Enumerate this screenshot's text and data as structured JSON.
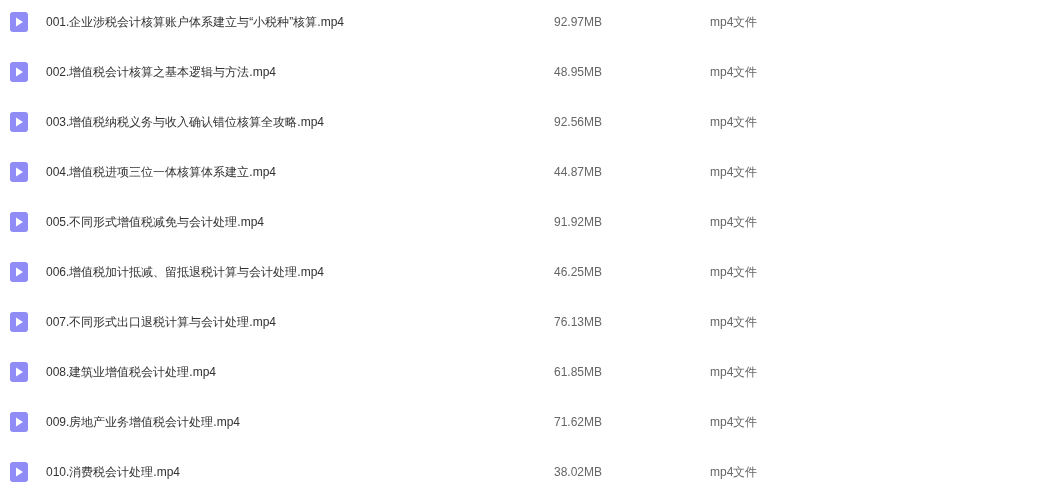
{
  "files": [
    {
      "name": "001.企业涉税会计核算账户体系建立与“小税种”核算.mp4",
      "size": "92.97MB",
      "type": "mp4文件"
    },
    {
      "name": "002.增值税会计核算之基本逻辑与方法.mp4",
      "size": "48.95MB",
      "type": "mp4文件"
    },
    {
      "name": "003.增值税纳税义务与收入确认错位核算全攻略.mp4",
      "size": "92.56MB",
      "type": "mp4文件"
    },
    {
      "name": "004.增值税进项三位一体核算体系建立.mp4",
      "size": "44.87MB",
      "type": "mp4文件"
    },
    {
      "name": "005.不同形式增值税减免与会计处理.mp4",
      "size": "91.92MB",
      "type": "mp4文件"
    },
    {
      "name": "006.增值税加计抵减、留抵退税计算与会计处理.mp4",
      "size": "46.25MB",
      "type": "mp4文件"
    },
    {
      "name": "007.不同形式出口退税计算与会计处理.mp4",
      "size": "76.13MB",
      "type": "mp4文件"
    },
    {
      "name": "008.建筑业增值税会计处理.mp4",
      "size": "61.85MB",
      "type": "mp4文件"
    },
    {
      "name": "009.房地产业务增值税会计处理.mp4",
      "size": "71.62MB",
      "type": "mp4文件"
    },
    {
      "name": "010.消费税会计处理.mp4",
      "size": "38.02MB",
      "type": "mp4文件"
    }
  ]
}
